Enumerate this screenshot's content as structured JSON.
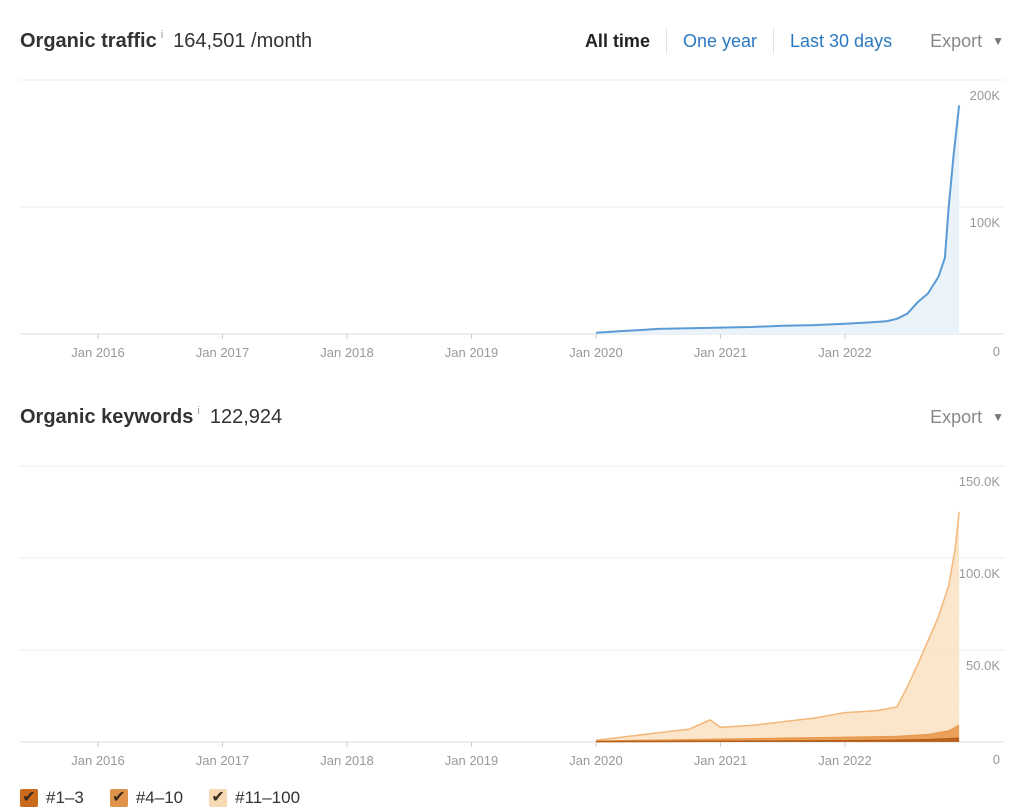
{
  "traffic_header": {
    "title": "Organic traffic",
    "info": "i",
    "value": "164,501 /month",
    "ranges": [
      "All time",
      "One year",
      "Last 30 days"
    ],
    "active_range": "All time",
    "export_label": "Export",
    "caret": "▼"
  },
  "keywords_header": {
    "title": "Organic keywords",
    "info": "i",
    "value": "122,924",
    "export_label": "Export",
    "caret": "▼"
  },
  "legend": [
    {
      "label": "#1–3",
      "color": "#c96a1c",
      "check": "✔"
    },
    {
      "label": "#4–10",
      "color": "#e0934a",
      "check": "✔"
    },
    {
      "label": "#11–100",
      "color": "#f7d9b4",
      "check": "✔"
    }
  ],
  "colors": {
    "traffic_line": "#5b9bd5",
    "traffic_fill": "#eaf3fa",
    "grid": "#ececec",
    "axis_text": "#999999",
    "kw_top3": "#b55e1a",
    "kw_4_10": "#e89a4e",
    "kw_11_100_fill": "#fbe3c6",
    "kw_11_100_line": "#f3b77a"
  },
  "chart_data": [
    {
      "type": "area",
      "title": "Organic traffic",
      "x_ticks": [
        "Jan 2016",
        "Jan 2017",
        "Jan 2018",
        "Jan 2019",
        "Jan 2020",
        "Jan 2021",
        "Jan 2022"
      ],
      "y_ticks": [
        "200K",
        "100K",
        "0"
      ],
      "ylim": [
        0,
        200000
      ],
      "grid": true,
      "series": [
        {
          "x": [
            "2020-01",
            "2020-04",
            "2020-07",
            "2020-10",
            "2021-01",
            "2021-04",
            "2021-07",
            "2021-10",
            "2022-01",
            "2022-03",
            "2022-05",
            "2022-06",
            "2022-07",
            "2022-08",
            "2022-09",
            "2022-10",
            "2022-10-20",
            "2022-11",
            "2022-11-15",
            "2022-12"
          ],
          "values": [
            1000,
            2500,
            4000,
            4500,
            5000,
            5500,
            6500,
            7000,
            8000,
            9000,
            10000,
            12000,
            16000,
            25000,
            32000,
            45000,
            60000,
            100000,
            140000,
            180000
          ]
        }
      ]
    },
    {
      "type": "area",
      "title": "Organic keywords",
      "x_ticks": [
        "Jan 2016",
        "Jan 2017",
        "Jan 2018",
        "Jan 2019",
        "Jan 2020",
        "Jan 2021",
        "Jan 2022"
      ],
      "y_ticks": [
        "150.0K",
        "100.0K",
        "50.0K",
        "0"
      ],
      "ylim": [
        0,
        150000
      ],
      "grid": true,
      "legend_position": "bottom-left",
      "series": [
        {
          "name": "#11–100",
          "x": [
            "2020-01",
            "2020-04",
            "2020-07",
            "2020-10",
            "2020-12",
            "2021-01",
            "2021-04",
            "2021-07",
            "2021-10",
            "2022-01",
            "2022-04",
            "2022-06",
            "2022-07",
            "2022-08",
            "2022-09",
            "2022-10",
            "2022-11",
            "2022-11-20",
            "2022-12"
          ],
          "values": [
            1000,
            3000,
            5000,
            7000,
            12000,
            8000,
            9000,
            11000,
            13000,
            16000,
            17000,
            19000,
            30000,
            42000,
            55000,
            68000,
            85000,
            105000,
            125000
          ]
        },
        {
          "name": "#4–10",
          "x": [
            "2020-01",
            "2020-07",
            "2021-01",
            "2021-07",
            "2022-01",
            "2022-06",
            "2022-09",
            "2022-11",
            "2022-12"
          ],
          "values": [
            500,
            1000,
            1500,
            2000,
            2500,
            3000,
            4000,
            6000,
            9000
          ]
        },
        {
          "name": "#1–3",
          "x": [
            "2020-01",
            "2021-01",
            "2022-01",
            "2022-06",
            "2022-09",
            "2022-12"
          ],
          "values": [
            200,
            400,
            700,
            900,
            1300,
            2000
          ]
        }
      ]
    }
  ]
}
